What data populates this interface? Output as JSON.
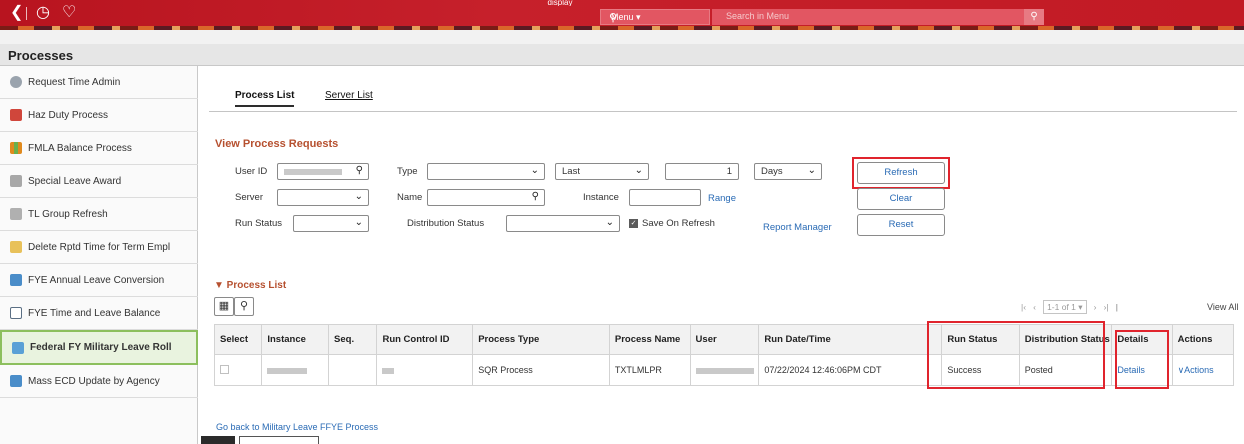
{
  "header": {
    "caption": "display",
    "menu_label": "Menu ▾",
    "search_placeholder": "Search in Menu",
    "back_icon": "chevron-left-icon",
    "recent_icon": "clock-icon",
    "favorites_icon": "heart-icon"
  },
  "page": {
    "title": "Processes"
  },
  "sidebar": {
    "items": [
      {
        "label": "Request Time Admin",
        "icon": "clock-icon",
        "color": "#9aa3ad"
      },
      {
        "label": "Haz Duty Process",
        "icon": "hazard-icon",
        "color": "#d0463b"
      },
      {
        "label": "FMLA Balance Process",
        "icon": "chart-icon",
        "color": "#e08a1e"
      },
      {
        "label": "Special Leave Award",
        "icon": "award-icon",
        "color": "#a8a8a8"
      },
      {
        "label": "TL Group Refresh",
        "icon": "list-icon",
        "color": "#b0b0b0"
      },
      {
        "label": "Delete Rptd Time for Term Empl",
        "icon": "delete-icon",
        "color": "#e8c15a"
      },
      {
        "label": "FYE Annual Leave Conversion",
        "icon": "calendar-icon",
        "color": "#4a8dc9"
      },
      {
        "label": "FYE Time and Leave Balance",
        "icon": "table-icon",
        "color": "#5b6f84"
      },
      {
        "label": "Federal FY Military Leave Roll",
        "icon": "process-icon",
        "color": "#5aa0d6"
      },
      {
        "label": "Mass ECD Update by Agency",
        "icon": "update-icon",
        "color": "#4a8dc9"
      }
    ],
    "active_index": 8
  },
  "tabs": [
    {
      "label": "Process List",
      "active": true
    },
    {
      "label": "Server List",
      "active": false
    }
  ],
  "form": {
    "section_title": "View Process Requests",
    "user_id_label": "User ID",
    "type_label": "Type",
    "last_value": "Last",
    "count_value": "1",
    "days_value": "Days",
    "server_label": "Server",
    "name_label": "Name",
    "instance_label": "Instance",
    "range_link": "Range",
    "run_status_label": "Run Status",
    "distribution_status_label": "Distribution Status",
    "save_on_refresh_label": "Save On Refresh",
    "report_manager_link": "Report Manager",
    "refresh_button": "Refresh",
    "clear_button": "Clear",
    "reset_button": "Reset"
  },
  "process_list": {
    "title": "▼ Process List",
    "pager_text": "1-1 of 1 ▾",
    "view_all": "View All",
    "columns": [
      "Select",
      "Instance",
      "Seq.",
      "Run Control ID",
      "Process Type",
      "Process Name",
      "User",
      "Run Date/Time",
      "Run Status",
      "Distribution Status",
      "Details",
      "Actions"
    ],
    "rows": [
      {
        "process_type": "SQR Process",
        "process_name": "TXTLMLPR",
        "run_date_time": "07/22/2024 12:46:06PM CDT",
        "run_status": "Success",
        "distribution_status": "Posted",
        "details": "Details",
        "actions": "∨Actions"
      }
    ]
  },
  "footer": {
    "go_back_link": "Go back to Military Leave FFYE Process"
  },
  "colors": {
    "header_red": "#c21a24",
    "highlight": "#e0242d",
    "link_blue": "#2a6bb5",
    "section_orange": "#b6502f"
  }
}
